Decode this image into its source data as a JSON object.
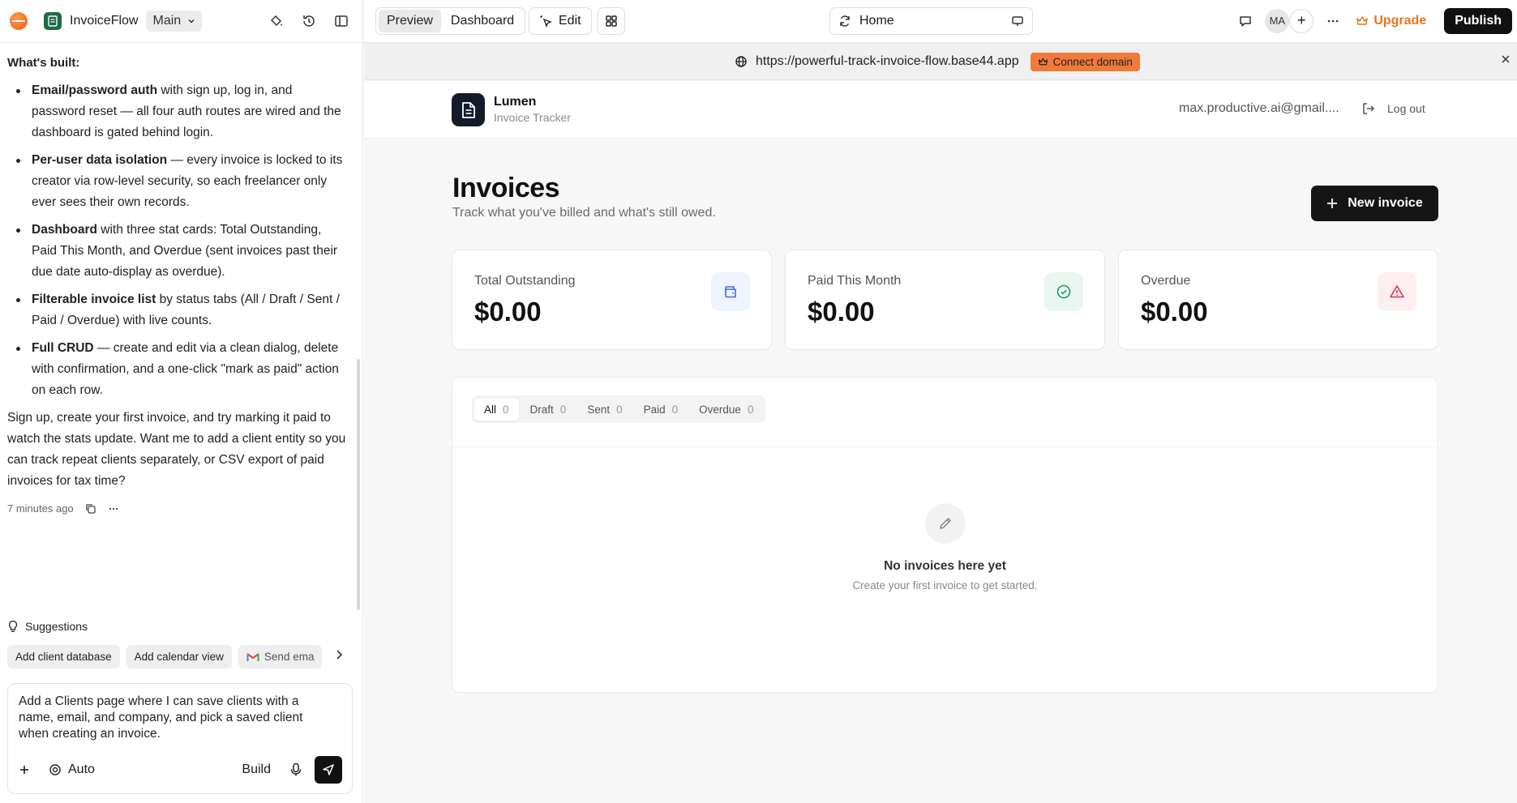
{
  "topbar": {
    "app_name": "InvoiceFlow",
    "branch": "Main",
    "view_tabs": [
      "Preview",
      "Dashboard"
    ],
    "edit_label": "Edit",
    "route": "Home",
    "avatar_initials": "MA",
    "upgrade_label": "Upgrade",
    "publish_label": "Publish",
    "accent_color": "#e8761e"
  },
  "chat": {
    "heading": "What's built:",
    "bullets": [
      {
        "bold": "Email/password auth",
        "text": " with sign up, log in, and password reset — all four auth routes are wired and the dashboard is gated behind login."
      },
      {
        "bold": "Per-user data isolation",
        "text": " — every invoice is locked to its creator via row-level security, so each freelancer only ever sees their own records."
      },
      {
        "bold": "Dashboard",
        "text": " with three stat cards: Total Outstanding, Paid This Month, and Overdue (sent invoices past their due date auto-display as overdue)."
      },
      {
        "bold": "Filterable invoice list",
        "text": " by status tabs (All / Draft / Sent / Paid / Overdue) with live counts."
      },
      {
        "bold": "Full CRUD",
        "text": " — create and edit via a clean dialog, delete with confirmation, and a one-click \"mark as paid\" action on each row."
      }
    ],
    "closing": "Sign up, create your first invoice, and try marking it paid to watch the stats update. Want me to add a client entity so you can track repeat clients separately, or CSV export of paid invoices for tax time?",
    "timestamp": "7 minutes ago",
    "suggestions_title": "Suggestions",
    "suggestions": [
      "Add client database",
      "Add calendar view",
      "Send ema"
    ],
    "composer_text": "Add a Clients page where I can save clients with a name, email, and company, and pick a saved client when creating an invoice.",
    "mode_label": "Auto",
    "build_label": "Build"
  },
  "preview": {
    "url": "https://powerful-track-invoice-flow.base44.app",
    "connect_domain": "Connect domain",
    "brand_name": "Lumen",
    "brand_sub": "Invoice Tracker",
    "user_email": "max.productive.ai@gmail....",
    "logout_label": "Log out",
    "page_title": "Invoices",
    "page_subtitle": "Track what you've billed and what's still owed.",
    "new_invoice_label": "New invoice",
    "stats": [
      {
        "label": "Total Outstanding",
        "value": "$0.00",
        "icon": "wallet-icon",
        "color": "#3a6fd8",
        "bg": "#eef3fd"
      },
      {
        "label": "Paid This Month",
        "value": "$0.00",
        "icon": "check-circle-icon",
        "color": "#1f9a6a",
        "bg": "#eaf7f1"
      },
      {
        "label": "Overdue",
        "value": "$0.00",
        "icon": "alert-triangle-icon",
        "color": "#d9344a",
        "bg": "#fdeef0"
      }
    ],
    "tabs": [
      {
        "label": "All",
        "count": "0"
      },
      {
        "label": "Draft",
        "count": "0"
      },
      {
        "label": "Sent",
        "count": "0"
      },
      {
        "label": "Paid",
        "count": "0"
      },
      {
        "label": "Overdue",
        "count": "0"
      }
    ],
    "empty_title": "No invoices here yet",
    "empty_sub": "Create your first invoice to get started."
  }
}
